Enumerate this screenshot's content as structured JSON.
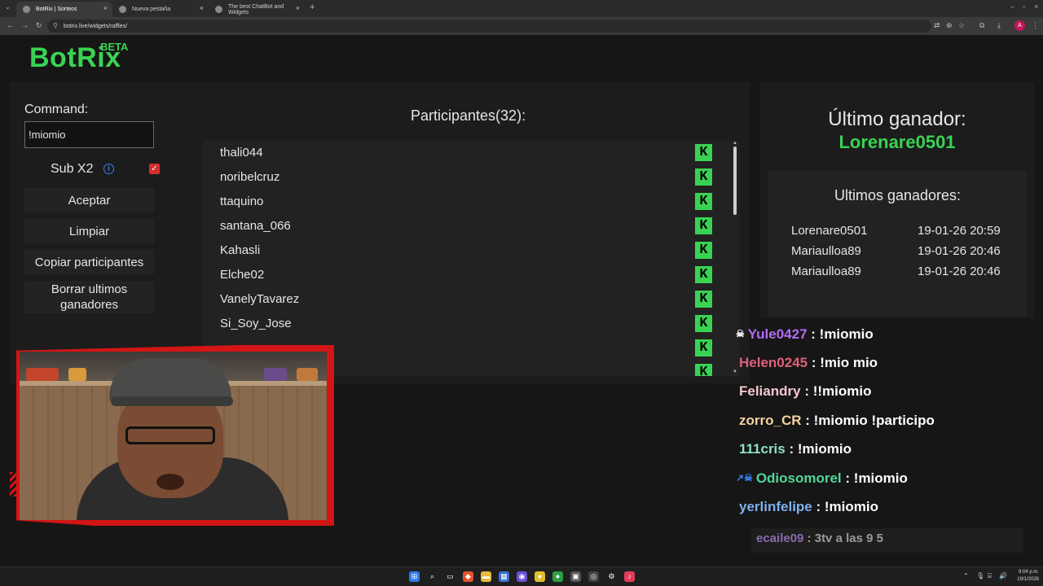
{
  "browser": {
    "tabs": [
      {
        "title": "BotRix | Sorteos",
        "active": true
      },
      {
        "title": "Nueva pestaña",
        "active": false
      },
      {
        "title": "The best ChatBot and Widgets",
        "active": false
      }
    ],
    "url": "botrix.live/widgets/raffles/",
    "profile_initial": "A"
  },
  "brand": {
    "name": "BotRix",
    "badge": "BETA",
    "accent": "#39d353"
  },
  "controls": {
    "command_label": "Command:",
    "command_value": "!miomio",
    "sub_label": "Sub X2",
    "sub_checked": true,
    "accept_label": "Aceptar",
    "clear_label": "Limpiar",
    "copy_label": "Copiar participantes",
    "delete_label": "Borrar ultimos ganadores"
  },
  "participants": {
    "title": "Participantes(32):",
    "platform_icon": "kick-icon",
    "items": [
      "thali044",
      "noribelcruz",
      "ttaquino",
      "santana_066",
      "Kahasli",
      "Elche02",
      "VanelyTavarez",
      "Si_Soy_Jose"
    ]
  },
  "winner": {
    "last_title": "Último ganador:",
    "last_name": "Lorenare0501",
    "recent_title": "Ultimos ganadores:",
    "recent": [
      {
        "name": "Lorenare0501",
        "date": "19-01-26 20:59"
      },
      {
        "name": "Mariaulloa89",
        "date": "19-01-26 20:46"
      },
      {
        "name": "Mariaulloa89",
        "date": "19-01-26 20:46"
      }
    ]
  },
  "chat": [
    {
      "user": "Yule0427",
      "message": " : !miomio",
      "color": "#b36cf0",
      "badge": "☠"
    },
    {
      "user": "Helen0245",
      "message": " : !mio mio",
      "color": "#e0607a",
      "badge": ""
    },
    {
      "user": "Feliandry",
      "message": " : !!miomio",
      "color": "#f7c6cf",
      "badge": ""
    },
    {
      "user": "zorro_CR",
      "message": " : !miomio !participo",
      "color": "#f2d2a0",
      "badge": ""
    },
    {
      "user": "111cris",
      "message": " : !miomio",
      "color": "#8fe0c8",
      "badge": ""
    },
    {
      "user": "Odiosomorel",
      "message": " : !miomio",
      "color": "#4fd69a",
      "badge": "↗☠"
    },
    {
      "user": "yerlinfelipe",
      "message": " : !miomio",
      "color": "#7fb0f0",
      "badge": ""
    },
    {
      "user": "ecaile09",
      "message": " : 3tv a las 9 5",
      "color": "#8a6bb0",
      "badge": ""
    }
  ],
  "taskbar": {
    "time": "9:04 p.m.",
    "date": "19/1/2026"
  }
}
